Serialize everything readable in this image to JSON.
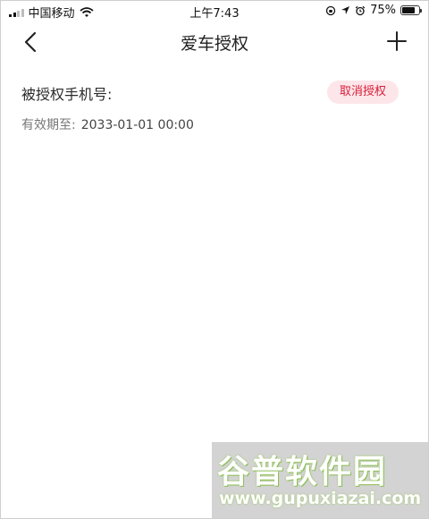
{
  "status_bar": {
    "carrier": "中国移动",
    "time": "上午7:43",
    "battery_percent": "75%",
    "battery_level": 0.75,
    "icons": [
      "signal-icon",
      "wifi-icon",
      "orientation-lock-icon",
      "location-icon",
      "alarm-icon",
      "battery-icon"
    ]
  },
  "nav": {
    "title": "爱车授权",
    "back_icon": "chevron-left-icon",
    "add_icon": "plus-icon"
  },
  "authorization": {
    "phone_label": "被授权手机号:",
    "cancel_label": "取消授权",
    "expiry_label": "有效期至:",
    "expiry_value": "2033-01-01 00:00"
  },
  "watermark": {
    "title": "谷普软件园",
    "url": "www.gupuxiazai.com"
  },
  "colors": {
    "accent": "#d81e3a",
    "accent_bg": "#fde6e9"
  }
}
